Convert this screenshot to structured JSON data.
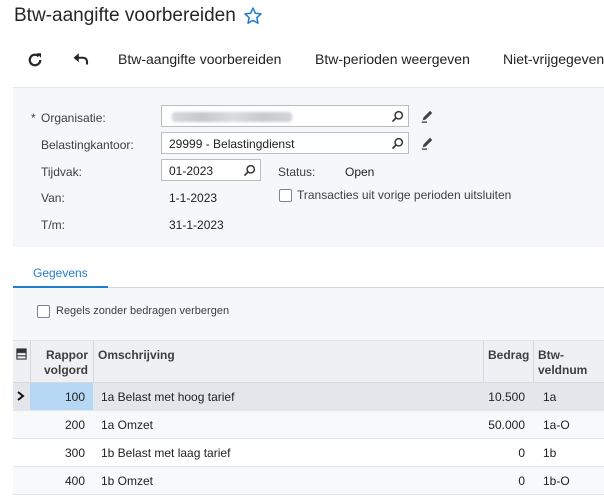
{
  "header": {
    "title": "Btw-aangifte voorbereiden",
    "favorite_icon": "star-outline-icon",
    "accent": "#1e7cd1"
  },
  "toolbar": {
    "refresh_icon": "refresh-icon",
    "undo_icon": "undo-icon",
    "buttons": [
      "Btw-aangifte voorbereiden",
      "Btw-perioden weergeven",
      "Niet-vrijgegeven"
    ]
  },
  "form": {
    "organisatie_label": "Organisatie:",
    "required_mark": "*",
    "belastingkantoor_label": "Belastingkantoor:",
    "belastingkantoor_value": "29999 - Belastingdienst",
    "tijdvak_label": "Tijdvak:",
    "tijdvak_value": "01-2023",
    "status_label": "Status:",
    "status_value": "Open",
    "van_label": "Van:",
    "van_value": "1-1-2023",
    "tm_label": "T/m:",
    "tm_value": "31-1-2023",
    "exclude_label": "Transacties uit vorige perioden uitsluiten"
  },
  "tabs": [
    {
      "label": "Gegevens",
      "active": true
    }
  ],
  "filter": {
    "hide_empty_label": "Regels zonder bedragen verbergen"
  },
  "grid": {
    "columns": {
      "rapport": "Rappor volgord",
      "omschrijving": "Omschrijving",
      "bedrag": "Bedrag",
      "veldnum": "Btw-veldnum"
    },
    "rows": [
      {
        "rapport": "100",
        "omschrijving": "1a Belast met hoog tarief",
        "bedrag": "10.500",
        "veldnum": "1a"
      },
      {
        "rapport": "200",
        "omschrijving": "1a Omzet",
        "bedrag": "50.000",
        "veldnum": "1a-O"
      },
      {
        "rapport": "300",
        "omschrijving": "1b Belast met laag tarief",
        "bedrag": "0",
        "veldnum": "1b"
      },
      {
        "rapport": "400",
        "omschrijving": "1b Omzet",
        "bedrag": "0",
        "veldnum": "1b-O"
      }
    ]
  }
}
